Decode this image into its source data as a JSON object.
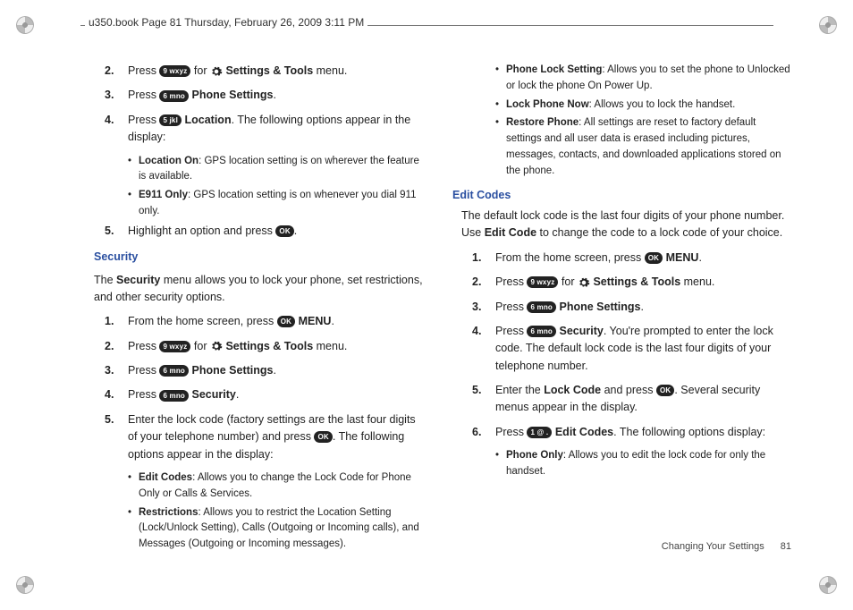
{
  "header": "u350.book  Page 81  Thursday, February 26, 2009  3:11 PM",
  "keys": {
    "ok": "OK",
    "k1": "1 @ .",
    "k5": "5 jkl",
    "k6": "6 mno",
    "k9": "9 wxyz"
  },
  "left": {
    "top_steps": [
      {
        "n": "2.",
        "pre": "Press ",
        "key": "k9",
        "mid": " for ",
        "gear": true,
        "post": " ",
        "bold": "Settings & Tools",
        "tail": " menu."
      },
      {
        "n": "3.",
        "pre": "Press ",
        "key": "k6",
        "mid": " ",
        "bold": "Phone Settings",
        "tail": "."
      },
      {
        "n": "4.",
        "pre": "Press ",
        "key": "k5",
        "mid": " ",
        "bold": "Location",
        "tail": ". The following options appear in the display:"
      }
    ],
    "top_subs": [
      {
        "bold": "Location On",
        "text": ": GPS location setting is on wherever the feature is available."
      },
      {
        "bold": "E911 Only",
        "text": ": GPS location setting is on whenever you dial 911 only."
      }
    ],
    "top_step5": {
      "n": "5.",
      "pre": "Highlight an option and press ",
      "key": "ok",
      "tail": "."
    },
    "security_heading": "Security",
    "security_para": "The <b>Security</b> menu allows you to lock your phone, set restrictions, and other security options.",
    "sec_steps": [
      {
        "n": "1.",
        "pre": "From the home screen, press ",
        "key": "ok",
        "mid": " ",
        "bold": "MENU",
        "tail": "."
      },
      {
        "n": "2.",
        "pre": "Press ",
        "key": "k9",
        "mid": " for ",
        "gear": true,
        "post": " ",
        "bold": "Settings & Tools",
        "tail": " menu."
      },
      {
        "n": "3.",
        "pre": "Press ",
        "key": "k6",
        "mid": " ",
        "bold": "Phone Settings",
        "tail": "."
      },
      {
        "n": "4.",
        "pre": "Press ",
        "key": "k6",
        "mid": " ",
        "bold": "Security",
        "tail": "."
      },
      {
        "n": "5.",
        "pre": "Enter the lock code (factory settings are the last four digits of your telephone number) and press ",
        "key": "ok",
        "tail": ". The following options appear in the display:"
      }
    ],
    "sec_subs": [
      {
        "bold": "Edit Codes",
        "text": ": Allows you to change the Lock Code for Phone Only or Calls & Services."
      }
    ]
  },
  "right": {
    "cont_subs": [
      {
        "bold": "Restrictions",
        "text": ": Allows you to restrict the Location Setting (Lock/Unlock Setting), Calls (Outgoing or Incoming calls), and Messages (Outgoing or Incoming messages)."
      },
      {
        "bold": "Phone Lock Setting",
        "text": ": Allows you to set the phone to Unlocked or lock the phone On Power Up."
      },
      {
        "bold": "Lock Phone Now",
        "text": ": Allows you to lock the handset."
      },
      {
        "bold": "Restore Phone",
        "text": ": All settings are reset to factory default settings and all user data is erased including pictures, messages, contacts, and downloaded applications stored on the phone."
      }
    ],
    "edit_heading": "Edit Codes",
    "edit_para": "The default lock code is the last four digits of your phone number. Use <b>Edit Code</b> to change the code to a lock code of your choice.",
    "edit_steps": [
      {
        "n": "1.",
        "pre": "From the home screen, press ",
        "key": "ok",
        "mid": " ",
        "bold": "MENU",
        "tail": "."
      },
      {
        "n": "2.",
        "pre": "Press ",
        "key": "k9",
        "mid": " for ",
        "gear": true,
        "post": " ",
        "bold": "Settings & Tools",
        "tail": " menu."
      },
      {
        "n": "3.",
        "pre": "Press ",
        "key": "k6",
        "mid": " ",
        "bold": "Phone Settings",
        "tail": "."
      },
      {
        "n": "4.",
        "pre": "Press ",
        "key": "k6",
        "mid": " ",
        "bold": "Security",
        "tail": ". You're prompted to enter the lock code. The default lock code is the last four digits of your telephone number."
      },
      {
        "n": "5.",
        "pre": "Enter the ",
        "boldPre": "Lock Code",
        "mid2": " and press ",
        "key": "ok",
        "tail": ". Several security menus appear in the display."
      },
      {
        "n": "6.",
        "pre": "Press ",
        "key": "k1",
        "mid": " ",
        "bold": "Edit Codes",
        "tail": ". The following options display:"
      }
    ],
    "edit_subs": [
      {
        "bold": "Phone Only",
        "text": ": Allows you to edit the lock code for only the handset."
      }
    ]
  },
  "footer": {
    "section": "Changing Your Settings",
    "page": "81"
  }
}
